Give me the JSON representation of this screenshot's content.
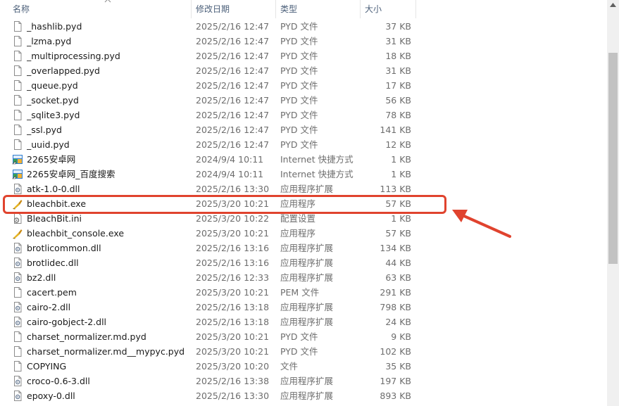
{
  "columns": {
    "name": "名称",
    "date": "修改日期",
    "type": "类型",
    "size": "大小"
  },
  "files": [
    {
      "name": "_hashlib.pyd",
      "date": "2025/2/16 12:47",
      "type": "PYD 文件",
      "size": "37 KB",
      "icon": "file-icon"
    },
    {
      "name": "_lzma.pyd",
      "date": "2025/2/16 12:47",
      "type": "PYD 文件",
      "size": "31 KB",
      "icon": "file-icon"
    },
    {
      "name": "_multiprocessing.pyd",
      "date": "2025/2/16 12:47",
      "type": "PYD 文件",
      "size": "18 KB",
      "icon": "file-icon"
    },
    {
      "name": "_overlapped.pyd",
      "date": "2025/2/16 12:47",
      "type": "PYD 文件",
      "size": "31 KB",
      "icon": "file-icon"
    },
    {
      "name": "_queue.pyd",
      "date": "2025/2/16 12:47",
      "type": "PYD 文件",
      "size": "17 KB",
      "icon": "file-icon"
    },
    {
      "name": "_socket.pyd",
      "date": "2025/2/16 12:47",
      "type": "PYD 文件",
      "size": "56 KB",
      "icon": "file-icon"
    },
    {
      "name": "_sqlite3.pyd",
      "date": "2025/2/16 12:47",
      "type": "PYD 文件",
      "size": "78 KB",
      "icon": "file-icon"
    },
    {
      "name": "_ssl.pyd",
      "date": "2025/2/16 12:47",
      "type": "PYD 文件",
      "size": "141 KB",
      "icon": "file-icon"
    },
    {
      "name": "_uuid.pyd",
      "date": "2025/2/16 12:47",
      "type": "PYD 文件",
      "size": "12 KB",
      "icon": "file-icon"
    },
    {
      "name": "2265安卓网",
      "date": "2024/9/4 10:11",
      "type": "Internet 快捷方式",
      "size": "1 KB",
      "icon": "url-shortcut-icon"
    },
    {
      "name": "2265安卓网_百度搜索",
      "date": "2024/9/4 10:11",
      "type": "Internet 快捷方式",
      "size": "1 KB",
      "icon": "url-shortcut-icon"
    },
    {
      "name": "atk-1.0-0.dll",
      "date": "2025/2/16 13:30",
      "type": "应用程序扩展",
      "size": "113 KB",
      "icon": "dll-icon"
    },
    {
      "name": "bleachbit.exe",
      "date": "2025/3/20 10:21",
      "type": "应用程序",
      "size": "57 KB",
      "icon": "bleachbit-icon"
    },
    {
      "name": "BleachBit.ini",
      "date": "2025/3/20 10:22",
      "type": "配置设置",
      "size": "1 KB",
      "icon": "ini-icon"
    },
    {
      "name": "bleachbit_console.exe",
      "date": "2025/3/20 10:21",
      "type": "应用程序",
      "size": "57 KB",
      "icon": "bleachbit-icon"
    },
    {
      "name": "brotlicommon.dll",
      "date": "2025/2/16 13:16",
      "type": "应用程序扩展",
      "size": "134 KB",
      "icon": "dll-icon"
    },
    {
      "name": "brotlidec.dll",
      "date": "2025/2/16 13:16",
      "type": "应用程序扩展",
      "size": "44 KB",
      "icon": "dll-icon"
    },
    {
      "name": "bz2.dll",
      "date": "2025/2/16 12:33",
      "type": "应用程序扩展",
      "size": "63 KB",
      "icon": "dll-icon"
    },
    {
      "name": "cacert.pem",
      "date": "2025/3/20 10:21",
      "type": "PEM 文件",
      "size": "291 KB",
      "icon": "file-icon"
    },
    {
      "name": "cairo-2.dll",
      "date": "2025/2/16 13:18",
      "type": "应用程序扩展",
      "size": "798 KB",
      "icon": "dll-icon"
    },
    {
      "name": "cairo-gobject-2.dll",
      "date": "2025/2/16 13:18",
      "type": "应用程序扩展",
      "size": "24 KB",
      "icon": "dll-icon"
    },
    {
      "name": "charset_normalizer.md.pyd",
      "date": "2025/3/20 10:21",
      "type": "PYD 文件",
      "size": "9 KB",
      "icon": "file-icon"
    },
    {
      "name": "charset_normalizer.md__mypyc.pyd",
      "date": "2025/3/20 10:21",
      "type": "PYD 文件",
      "size": "102 KB",
      "icon": "file-icon"
    },
    {
      "name": "COPYING",
      "date": "2025/3/20 10:20",
      "type": "文件",
      "size": "35 KB",
      "icon": "file-icon"
    },
    {
      "name": "croco-0.6-3.dll",
      "date": "2025/2/16 13:38",
      "type": "应用程序扩展",
      "size": "197 KB",
      "icon": "dll-icon"
    },
    {
      "name": "epoxy-0.dll",
      "date": "2025/2/16 13:30",
      "type": "应用程序扩展",
      "size": "893 KB",
      "icon": "dll-icon"
    }
  ],
  "highlight_row": 12,
  "colors": {
    "annotation": "#e0432e",
    "header_text": "#4c607a"
  }
}
